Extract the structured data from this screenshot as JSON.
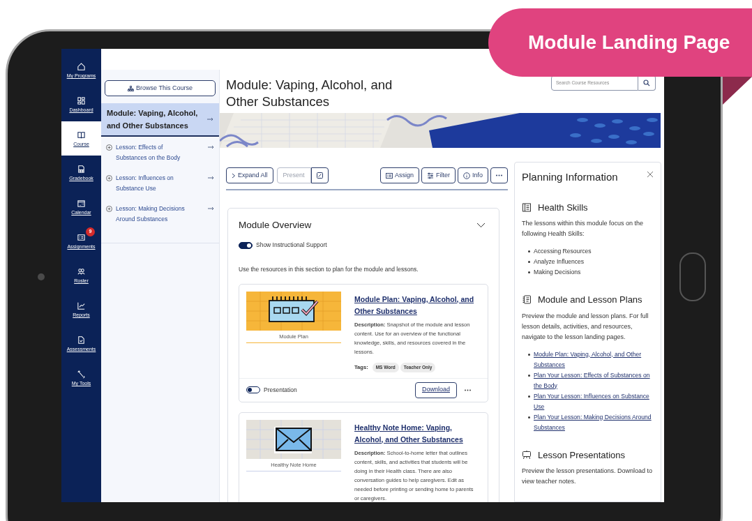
{
  "callout": "Module Landing Page",
  "nav_rail": {
    "items": [
      {
        "label": "My Programs",
        "selected": false
      },
      {
        "label": "Dashboard",
        "selected": false
      },
      {
        "label": "Course",
        "selected": true
      },
      {
        "label": "Gradebook",
        "selected": false
      },
      {
        "label": "Calendar",
        "selected": false
      },
      {
        "label": "Assignments",
        "selected": false,
        "badge": "9"
      },
      {
        "label": "Roster",
        "selected": false
      },
      {
        "label": "Reports",
        "selected": false
      },
      {
        "label": "Assessments",
        "selected": false
      },
      {
        "label": "My Tools",
        "selected": false
      }
    ]
  },
  "course_panel": {
    "browse_button": "Browse This Course",
    "items": [
      {
        "kind": "module",
        "label": "Module: Vaping, Alcohol, and Other Substances",
        "selected": true
      },
      {
        "kind": "lesson",
        "label": "Lesson: Effects of Substances on the Body",
        "selected": false
      },
      {
        "kind": "lesson",
        "label": "Lesson: Influences on Substance Use",
        "selected": false
      },
      {
        "kind": "lesson",
        "label": "Lesson: Making Decisions Around Substances",
        "selected": false
      }
    ]
  },
  "header": {
    "title": "Module: Vaping, Alcohol, and Other Substances",
    "search": {
      "placeholder": "Search Course Resources"
    }
  },
  "toolbar": {
    "expand_all": "Expand All",
    "present": {
      "label": "Present",
      "disabled": true
    },
    "actions": [
      "Assign",
      "Filter",
      "Info"
    ]
  },
  "overview": {
    "title": "Module Overview",
    "expanded": true,
    "toggle": {
      "label": "Show Instructional Support",
      "on": true
    },
    "intro": "Use the resources in this section to plan for the module and lessons.",
    "resources": [
      {
        "kind": "planner",
        "caption": "Module Plan",
        "title": "Module Plan: Vaping, Alcohol, and Other Substances",
        "description": "**Description:** Snapshot of the module and lesson content. Use for an overview of the functional knowledge, skills, and resources covered in the lessons.",
        "tags_label": "Tags:",
        "tags": [
          "MS Word",
          "Teacher Only"
        ],
        "presentation": {
          "label": "Presentation",
          "on": false
        },
        "download": "Download"
      },
      {
        "kind": "envelope",
        "caption": "Healthy Note Home",
        "title": "Healthy Note Home: Vaping, Alcohol, and Other Substances",
        "description": "**Description:** School-to-home letter that outlines content, skills, and activities that students will be doing in their Health class. There are also conversation guides to help caregivers. Edit as needed before printing or sending home to parents or caregivers."
      }
    ]
  },
  "planning": {
    "title": "Planning Information",
    "sections": [
      {
        "title": "Health Skills",
        "text": "The lessons within this module focus on the following Health Skills:",
        "items": [
          {
            "text": "Accessing Resources",
            "link": false
          },
          {
            "text": "Analyze Influences",
            "link": false
          },
          {
            "text": "Making Decisions",
            "link": false
          }
        ]
      },
      {
        "title": "Module and Lesson Plans",
        "text": "Preview the module and lesson plans. For full lesson details, activities, and resources, navigate to the lesson landing pages.",
        "items": [
          {
            "text": "Module Plan: Vaping, Alcohol, and Other Substances",
            "link": true
          },
          {
            "text": "Plan Your Lesson: Effects of Substances on the Body",
            "link": true
          },
          {
            "text": "Plan Your Lesson: Influences on Substance Use",
            "link": true
          },
          {
            "text": "Plan Your Lesson: Making Decisions Around Substances",
            "link": true
          }
        ]
      },
      {
        "title": "Lesson Presentations",
        "text": "Preview the lesson presentations. Download to view teacher notes."
      }
    ]
  }
}
